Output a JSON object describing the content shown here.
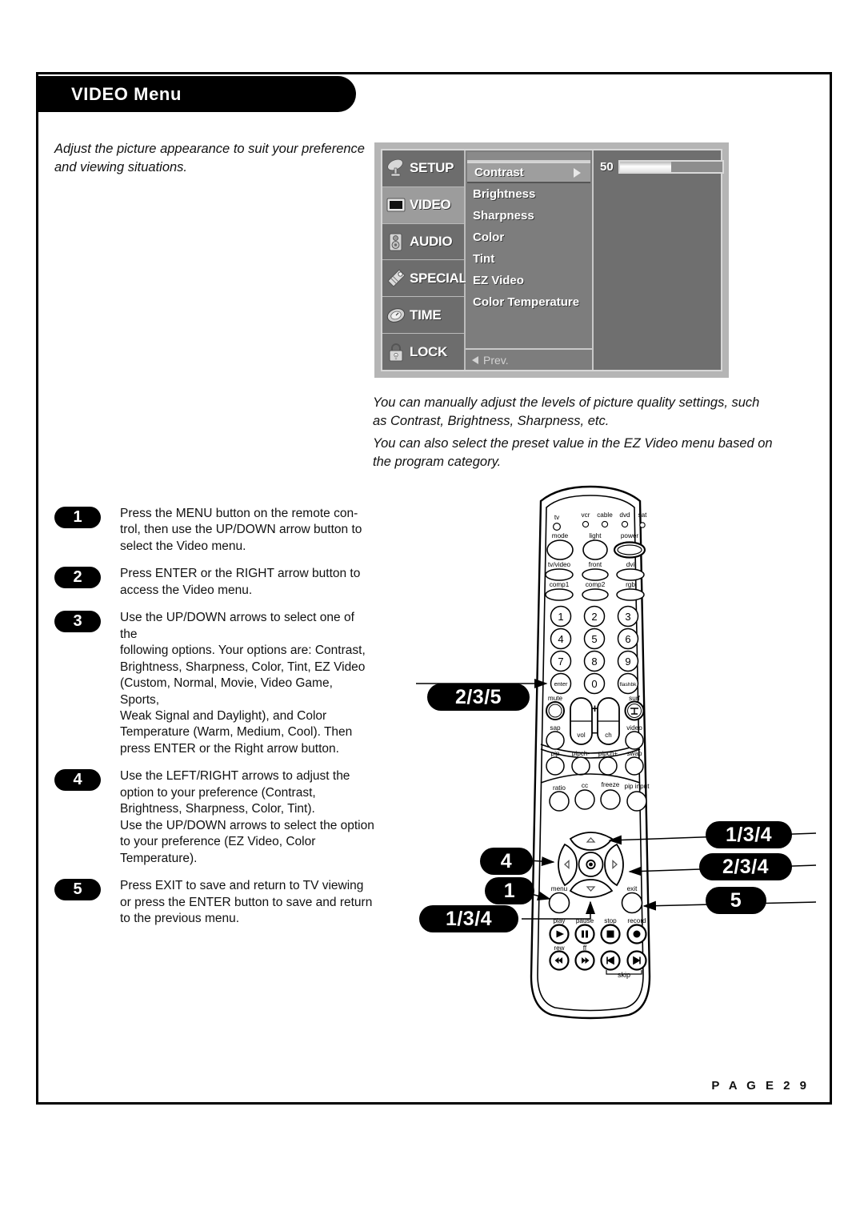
{
  "header": {
    "title": "VIDEO Menu"
  },
  "intro": {
    "text": "Adjust the picture appearance to suit your preference and viewing situations."
  },
  "osd": {
    "categories": [
      {
        "label": "SETUP",
        "icon": "satellite-dish-icon",
        "active": false
      },
      {
        "label": "VIDEO",
        "icon": "tv-screen-icon",
        "active": true
      },
      {
        "label": "AUDIO",
        "icon": "speaker-icon",
        "active": false
      },
      {
        "label": "SPECIAL",
        "icon": "tag-icon",
        "active": false
      },
      {
        "label": "TIME",
        "icon": "clock-icon",
        "active": false
      },
      {
        "label": "LOCK",
        "icon": "padlock-icon",
        "active": false
      }
    ],
    "items": [
      {
        "label": "Contrast",
        "selected": true
      },
      {
        "label": "Brightness",
        "selected": false
      },
      {
        "label": "Sharpness",
        "selected": false
      },
      {
        "label": "Color",
        "selected": false
      },
      {
        "label": "Tint",
        "selected": false
      },
      {
        "label": "EZ Video",
        "selected": false
      },
      {
        "label": "Color Temperature",
        "selected": false
      }
    ],
    "prev_label": "Prev.",
    "value": "50",
    "value_percent": 50
  },
  "explanations": [
    "You can manually adjust the levels of picture quality settings, such as Contrast, Brightness, Sharpness, etc.",
    "You can also select the preset value in the EZ Video menu based on the program category."
  ],
  "steps": [
    {
      "number": "1",
      "lines": [
        "Press the MENU button on the remote con-",
        "trol, then use the UP/DOWN arrow button to",
        "select the Video menu."
      ]
    },
    {
      "number": "2",
      "lines": [
        "Press ENTER or the RIGHT arrow button to",
        "access the Video menu."
      ]
    },
    {
      "number": "3",
      "lines": [
        "Use the UP/DOWN arrows to select one of the",
        "following options. Your options are: Contrast,",
        "Brightness, Sharpness, Color, Tint, EZ Video",
        "(Custom, Normal, Movie, Video Game, Sports,",
        "Weak Signal and Daylight), and Color",
        "Temperature (Warm, Medium, Cool). Then",
        "press ENTER or the Right arrow button."
      ]
    },
    {
      "number": "4",
      "lines": [
        "Use the LEFT/RIGHT arrows to adjust the",
        "option to your preference (Contrast,",
        "Brightness, Sharpness, Color, Tint).",
        "Use the UP/DOWN arrows to select the option",
        "to your preference (EZ Video, Color",
        "Temperature)."
      ]
    },
    {
      "number": "5",
      "lines": [
        "Press EXIT to save and return to TV viewing",
        "or press the ENTER button to save and return",
        "to the previous menu."
      ]
    }
  ],
  "callouts": [
    {
      "label": "2/3/5",
      "target": "enter-button"
    },
    {
      "label": "1/3/4",
      "target": "up-arrow-button"
    },
    {
      "label": "2/3/4",
      "target": "right-arrow-button"
    },
    {
      "label": "5",
      "target": "exit-button"
    },
    {
      "label": "4",
      "target": "left-arrow-button"
    },
    {
      "label": "1",
      "target": "menu-button"
    },
    {
      "label": "1/3/4",
      "target": "down-arrow-button"
    }
  ],
  "remote": {
    "mode_leds": [
      "tv",
      "vcr",
      "cable",
      "dvd",
      "sat"
    ],
    "row_mode": [
      "mode",
      "light",
      "power"
    ],
    "row_input1": [
      "tv/video",
      "front",
      "dvi"
    ],
    "row_input2": [
      "comp1",
      "comp2",
      "rgb"
    ],
    "keypad": [
      "1",
      "2",
      "3",
      "4",
      "5",
      "6",
      "7",
      "8",
      "9",
      "enter",
      "0",
      "flashbk"
    ],
    "side_left": [
      "mute",
      "sap"
    ],
    "side_right": [
      "surf",
      "video"
    ],
    "rocker_left": "vol",
    "rocker_right": "ch",
    "rocker_plus": "+",
    "rocker_minus": "–",
    "row_pip": [
      "pip",
      "pipch-",
      "pipch+",
      "swap"
    ],
    "row_ratio": [
      "ratio",
      "cc",
      "freeze",
      "pip input"
    ],
    "nav_menu": "menu",
    "nav_exit": "exit",
    "transport_top": [
      "play",
      "pause",
      "stop",
      "record"
    ],
    "transport_bottom": [
      "rew",
      "ff"
    ],
    "skip_label": "skip"
  },
  "footer": {
    "page_label": "P A G E   2 9"
  }
}
